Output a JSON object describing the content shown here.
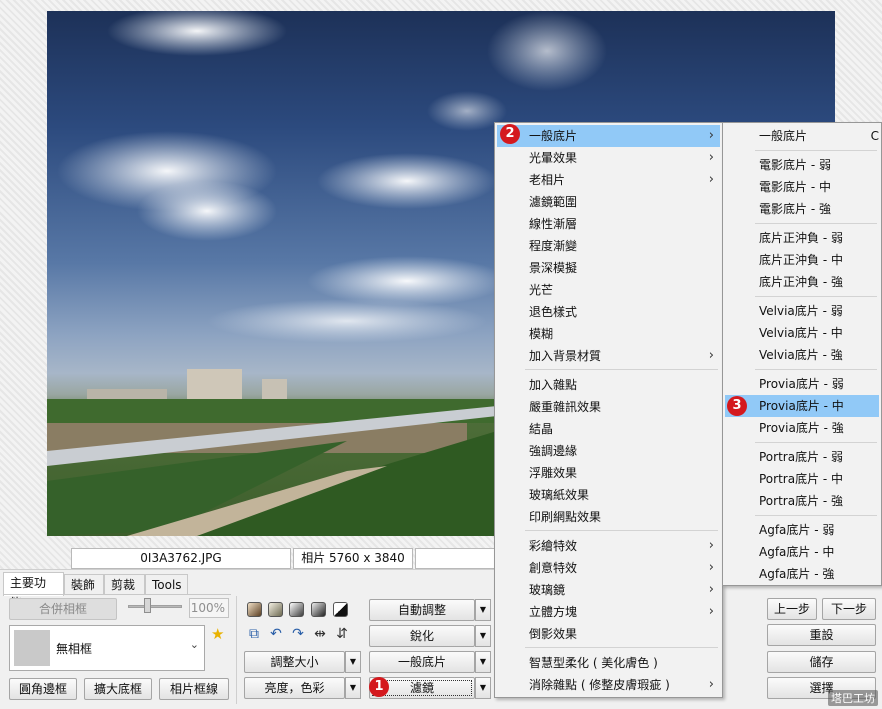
{
  "info_bar": {
    "filename": "0I3A3762.JPG",
    "dimensions": "相片 5760 x 3840"
  },
  "tabs": [
    {
      "label": "主要功能"
    },
    {
      "label": "裝飾"
    },
    {
      "label": "剪裁"
    },
    {
      "label": "Tools"
    }
  ],
  "frame_panel": {
    "merge_button": "合併相框",
    "zoom_value": "100%",
    "frame_value": "無相框",
    "rounded_border": "圓角邊框",
    "expand_border": "擴大底框",
    "photo_frame_line": "相片框線"
  },
  "adjust_panel": {
    "resize": "調整大小",
    "brightness_color": "亮度，色彩",
    "auto_adjust": "自動調整",
    "sharpen": "銳化",
    "normal_film": "一般底片",
    "filter": "濾鏡"
  },
  "right_buttons": {
    "prev": "上一步",
    "next": "下一步",
    "reset": "重設",
    "save": "儲存",
    "select": "選擇"
  },
  "filter_menu": {
    "items": [
      {
        "label": "一般底片"
      },
      {
        "label": "光暈效果"
      },
      {
        "label": "老相片"
      },
      {
        "label": "濾鏡範圍"
      },
      {
        "label": "線性漸層"
      },
      {
        "label": "程度漸變"
      },
      {
        "label": "景深模擬"
      },
      {
        "label": "光芒"
      },
      {
        "label": "退色樣式"
      },
      {
        "label": "模糊"
      },
      {
        "label": "加入背景材質"
      },
      {
        "label": "加入雜點"
      },
      {
        "label": "嚴重雜訊效果"
      },
      {
        "label": "結晶"
      },
      {
        "label": "強調邊緣"
      },
      {
        "label": "浮雕效果"
      },
      {
        "label": "玻璃紙效果"
      },
      {
        "label": "印刷網點效果"
      },
      {
        "label": "彩繪特效"
      },
      {
        "label": "創意特效"
      },
      {
        "label": "玻璃鏡"
      },
      {
        "label": "立體方塊"
      },
      {
        "label": "倒影效果"
      },
      {
        "label": "智慧型柔化 ( 美化膚色 )"
      },
      {
        "label": "消除雜點 ( 修整皮膚瑕疵 )"
      }
    ]
  },
  "film_menu": {
    "items": [
      {
        "label": "一般底片",
        "shortcut": "C"
      },
      {
        "label": "電影底片 - 弱"
      },
      {
        "label": "電影底片 - 中"
      },
      {
        "label": "電影底片 - 強"
      },
      {
        "label": "底片正沖負 - 弱"
      },
      {
        "label": "底片正沖負 - 中"
      },
      {
        "label": "底片正沖負 - 強"
      },
      {
        "label": "Velvia底片 - 弱"
      },
      {
        "label": "Velvia底片 - 中"
      },
      {
        "label": "Velvia底片 - 強"
      },
      {
        "label": "Provia底片 - 弱"
      },
      {
        "label": "Provia底片 - 中"
      },
      {
        "label": "Provia底片 - 強"
      },
      {
        "label": "Portra底片 - 弱"
      },
      {
        "label": "Portra底片 - 中"
      },
      {
        "label": "Portra底片 - 強"
      },
      {
        "label": "Agfa底片 - 弱"
      },
      {
        "label": "Agfa底片 - 中"
      },
      {
        "label": "Agfa底片 - 強"
      }
    ]
  },
  "badges": {
    "one": "1",
    "two": "2",
    "three": "3"
  },
  "watermark": "塔巴工坊",
  "colors": {
    "highlight": "#91c9f7",
    "badge": "#d4191e"
  },
  "icons": [
    "star-icon",
    "chevron-down-icon",
    "chevron-right-icon",
    "rotate-left-icon",
    "rotate-right-icon",
    "flip-icon",
    "crop-icon"
  ]
}
